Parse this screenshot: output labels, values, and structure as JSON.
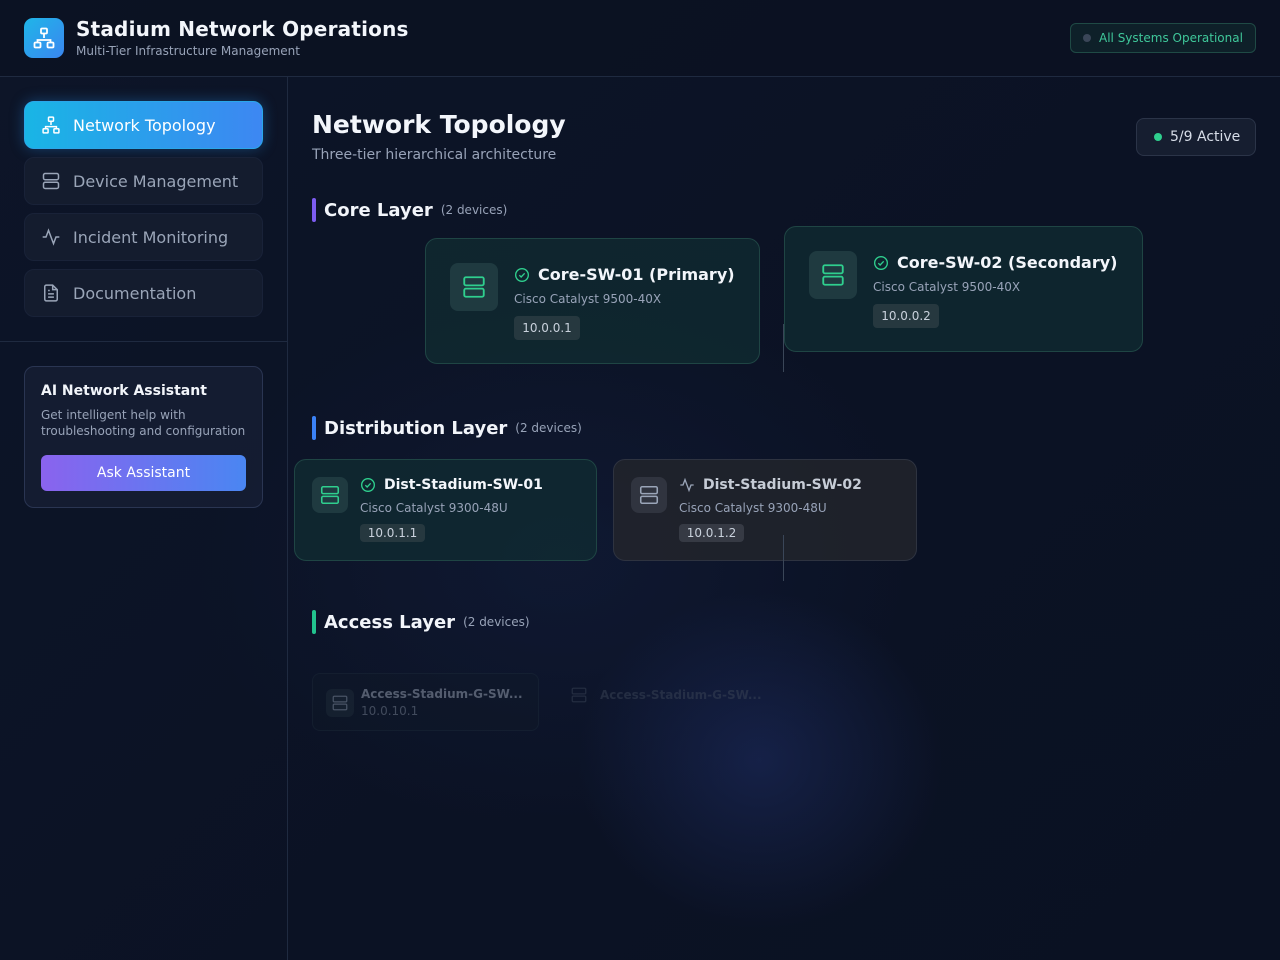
{
  "header": {
    "title": "Stadium Network Operations",
    "subtitle": "Multi-Tier Infrastructure Management",
    "status": "All Systems Operational"
  },
  "sidebar": {
    "items": [
      {
        "label": "Network Topology",
        "icon": "network-icon",
        "active": true
      },
      {
        "label": "Device Management",
        "icon": "server-icon",
        "active": false
      },
      {
        "label": "Incident Monitoring",
        "icon": "activity-icon",
        "active": false
      },
      {
        "label": "Documentation",
        "icon": "document-icon",
        "active": false
      }
    ],
    "assistant": {
      "title": "AI Network Assistant",
      "description": "Get intelligent help with troubleshooting and configuration",
      "button": "Ask Assistant"
    }
  },
  "main": {
    "title": "Network Topology",
    "subtitle": "Three-tier hierarchical architecture",
    "active_badge": "5/9 Active",
    "layers": [
      {
        "name": "Core Layer",
        "count": "(2 devices)",
        "color": "#7c5cf0",
        "devices": [
          {
            "name": "Core-SW-01 (Primary)",
            "model": "Cisco Catalyst 9500-40X",
            "ip": "10.0.0.1",
            "status": "online"
          },
          {
            "name": "Core-SW-02 (Secondary)",
            "model": "Cisco Catalyst 9500-40X",
            "ip": "10.0.0.2",
            "status": "online"
          }
        ]
      },
      {
        "name": "Distribution Layer",
        "count": "(2 devices)",
        "color": "#3b82f6",
        "devices": [
          {
            "name": "Dist-Stadium-SW-01",
            "model": "Cisco Catalyst 9300-48U",
            "ip": "10.0.1.1",
            "status": "online"
          },
          {
            "name": "Dist-Stadium-SW-02",
            "model": "Cisco Catalyst 9300-48U",
            "ip": "10.0.1.2",
            "status": "degraded"
          }
        ]
      },
      {
        "name": "Access Layer",
        "count": "(2 devices)",
        "color": "#22c38e",
        "devices": [
          {
            "name": "Access-Stadium-G-SW...",
            "ip": "10.0.10.1"
          },
          {
            "name": "Access-Stadium-G-SW..."
          }
        ]
      }
    ]
  },
  "colors": {
    "online": "#2fcf8e",
    "accent": "#3d87f2",
    "assistant_gradient_start": "#8a63ee"
  }
}
